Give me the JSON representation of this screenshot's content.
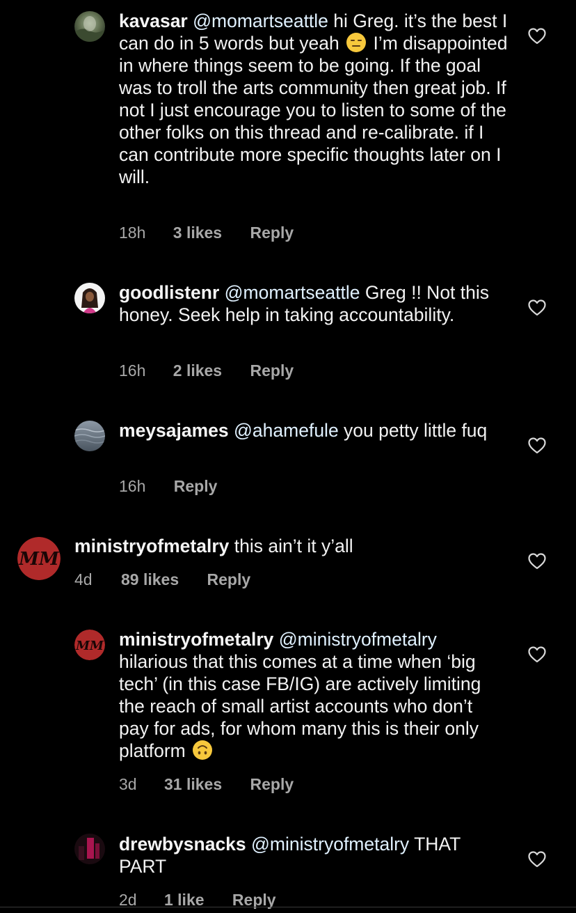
{
  "comments": [
    {
      "username": "kavasar",
      "mention": "@momartseattle",
      "text_before_emoji": " hi Greg. it’s the best I can do in 5 words but yeah ",
      "emoji": "expressionless-face",
      "text_after_emoji": " I’m disappointed in where things seem to be going. If the goal was to troll the arts community then great job. If not I just encourage you to listen to some of the other folks on this thread and re-calibrate. if I can contribute more specific thoughts later on I will.",
      "time": "18h",
      "likes": "3 likes",
      "reply_label": "Reply"
    },
    {
      "username": "goodlistenr",
      "mention": "@momartseattle",
      "text": " Greg !! Not this honey. Seek help in taking accountability.",
      "time": "16h",
      "likes": "2 likes",
      "reply_label": "Reply"
    },
    {
      "username": "meysajames",
      "mention": "@ahamefule",
      "text": " you petty little fuq",
      "time": "16h",
      "reply_label": "Reply"
    },
    {
      "username": "ministryofmetalry",
      "text": " this ain’t it y’all",
      "time": "4d",
      "likes": "89 likes",
      "reply_label": "Reply",
      "avatar_letters": "MM"
    },
    {
      "username": "ministryofmetalry",
      "mention": "@ministryofmetalry",
      "text_before_emoji": " hilarious that this comes at a time when ‘big tech’ (in this case FB/IG) are actively limiting the reach of small artist accounts who don’t pay for ads, for whom many this is their only platform ",
      "emoji": "upside-down-face",
      "time": "3d",
      "likes": "31 likes",
      "reply_label": "Reply",
      "avatar_letters": "MM"
    },
    {
      "username": "drewbysnacks",
      "mention": "@ministryofmetalry",
      "text": " THAT PART",
      "time": "2d",
      "likes": "1 like",
      "reply_label": "Reply"
    }
  ],
  "colors": {
    "background": "#000000",
    "text": "#f5f5f5",
    "meta": "#a8a8a8",
    "mention": "#e0f1ff",
    "heart": "#d8d8d8",
    "metalry_red": "#b02a2a"
  }
}
